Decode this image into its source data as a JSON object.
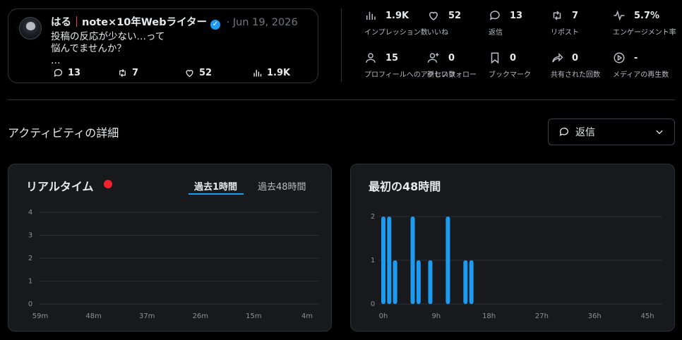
{
  "tweet": {
    "name": "はる",
    "handle_title": "note×10年Webライター",
    "date": "Jun 19, 2026",
    "body": "投稿の反応が少ない…って\n悩んでませんか？\n…",
    "replies": "13",
    "reposts": "7",
    "likes": "52",
    "views": "1.9K"
  },
  "metrics": [
    {
      "icon": "bar-chart-icon",
      "value": "1.9K",
      "label": "インプレッション数"
    },
    {
      "icon": "heart-icon",
      "value": "52",
      "label": "いいね"
    },
    {
      "icon": "reply-icon",
      "value": "13",
      "label": "返信"
    },
    {
      "icon": "repost-icon",
      "value": "7",
      "label": "リポスト"
    },
    {
      "icon": "engagement-icon",
      "value": "5.7%",
      "label": "エンゲージメント率"
    },
    {
      "icon": "profile-icon",
      "value": "15",
      "label": "プロフィールへのアクセス数"
    },
    {
      "icon": "follow-icon",
      "value": "0",
      "label": "新しいフォロー"
    },
    {
      "icon": "bookmark-icon",
      "value": "0",
      "label": "ブックマーク"
    },
    {
      "icon": "share-icon",
      "value": "0",
      "label": "共有された回数"
    },
    {
      "icon": "play-icon",
      "value": "-",
      "label": "メディアの再生数"
    }
  ],
  "activity": {
    "title": "アクティビティの詳細",
    "dropdown_selected": "返信"
  },
  "realtime": {
    "title": "リアルタイム",
    "tabs": [
      "過去1時間",
      "過去48時間"
    ],
    "active_tab": 0
  },
  "first48": {
    "title": "最初の48時間"
  },
  "colors": {
    "accent": "#1d9bf0",
    "live_dot": "#f4212e",
    "bar": "#1d9bf0"
  },
  "chart_data": [
    {
      "type": "bar",
      "y_ticks": [
        0,
        1,
        2,
        3,
        4
      ],
      "x_ticks": [
        "59m",
        "48m",
        "37m",
        "26m",
        "15m",
        "4m"
      ],
      "ylim": [
        0,
        4
      ],
      "values": [],
      "grid": true
    },
    {
      "type": "bar",
      "y_ticks": [
        0,
        1,
        2
      ],
      "x_ticks": [
        "0h",
        "9h",
        "18h",
        "27h",
        "36h",
        "45h"
      ],
      "ylim": [
        0,
        2
      ],
      "xlim": [
        0,
        48
      ],
      "x": [
        0,
        1,
        2,
        5,
        6,
        8,
        11,
        14,
        15
      ],
      "values": [
        2,
        2,
        1,
        2,
        1,
        1,
        2,
        1,
        1
      ],
      "grid": true
    }
  ]
}
